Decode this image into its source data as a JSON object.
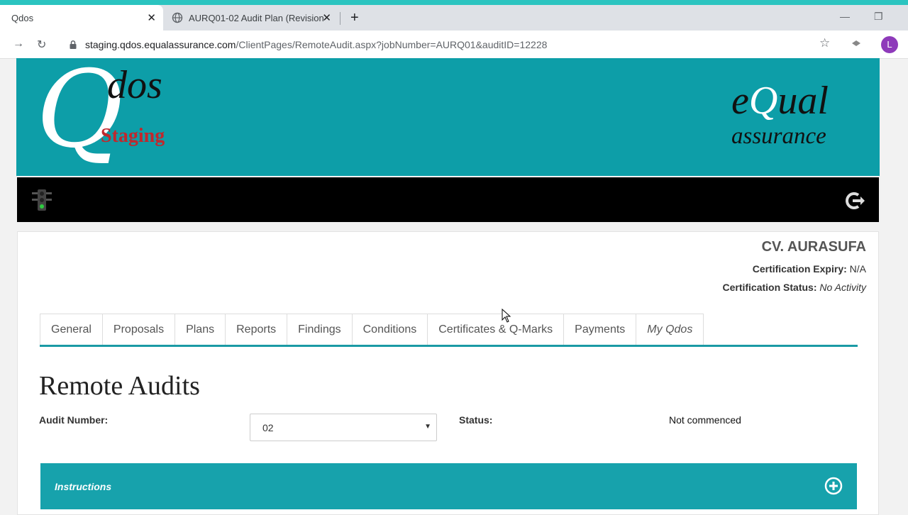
{
  "browser": {
    "tabs": [
      {
        "title": "Qdos",
        "active": true
      },
      {
        "title": "AURQ01-02 Audit Plan (Revision",
        "active": false
      }
    ],
    "url_host": "staging.qdos.equalassurance.com",
    "url_path": "/ClientPages/RemoteAudit.aspx?jobNumber=AURQ01&auditID=12228",
    "avatar_letter": "L"
  },
  "banner": {
    "logo_q": "Q",
    "logo_dos": "dos",
    "environment": "Staging",
    "brand_e": "e",
    "brand_q": "Q",
    "brand_ual": "ual",
    "brand_sub": "assurance"
  },
  "client": {
    "name": "CV. AURASUFA",
    "expiry_label": "Certification Expiry:",
    "expiry_value": "N/A",
    "status_label": "Certification Status:",
    "status_value": "No Activity"
  },
  "nav_tabs": [
    "General",
    "Proposals",
    "Plans",
    "Reports",
    "Findings",
    "Conditions",
    "Certificates & Q-Marks",
    "Payments",
    "My Qdos"
  ],
  "page": {
    "title": "Remote Audits",
    "audit_number_label": "Audit Number:",
    "audit_number_value": "02",
    "status_label": "Status:",
    "status_value": "Not commenced",
    "instructions_label": "Instructions"
  },
  "colors": {
    "teal": "#0d9ea8",
    "staging_red": "#c0282d",
    "avatar_purple": "#8e3aba"
  }
}
